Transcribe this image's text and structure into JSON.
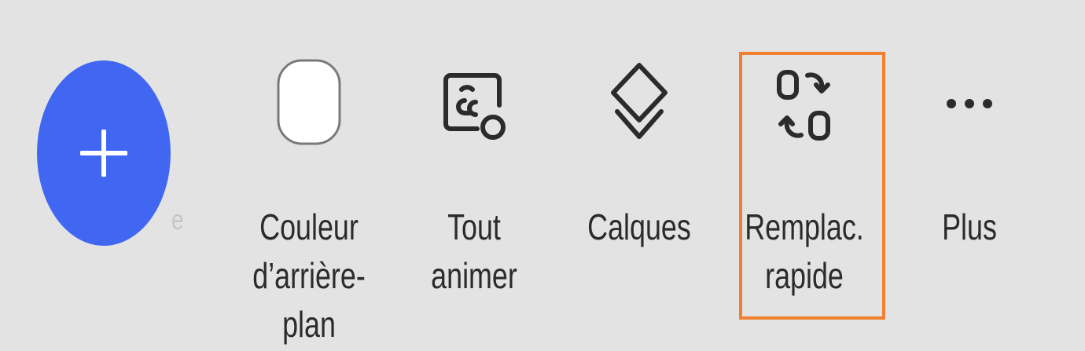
{
  "toolbar": {
    "add_button": {
      "icon": "plus-icon",
      "color": "#4167f2"
    },
    "peek_label": "e",
    "items": [
      {
        "id": "background-color",
        "label": "Couleur\nd’arrière-\nplan",
        "icon": "rounded-square-swatch-icon"
      },
      {
        "id": "animate-all",
        "label": "Tout\nanimer",
        "icon": "animate-all-icon"
      },
      {
        "id": "layers",
        "label": "Calques",
        "icon": "layers-icon"
      },
      {
        "id": "quick-replace",
        "label": "Remplac.\nrapide",
        "icon": "swap-replace-icon",
        "highlighted": true
      },
      {
        "id": "more",
        "label": "Plus",
        "icon": "ellipsis-icon"
      }
    ],
    "highlight_color": "#f0802f"
  }
}
